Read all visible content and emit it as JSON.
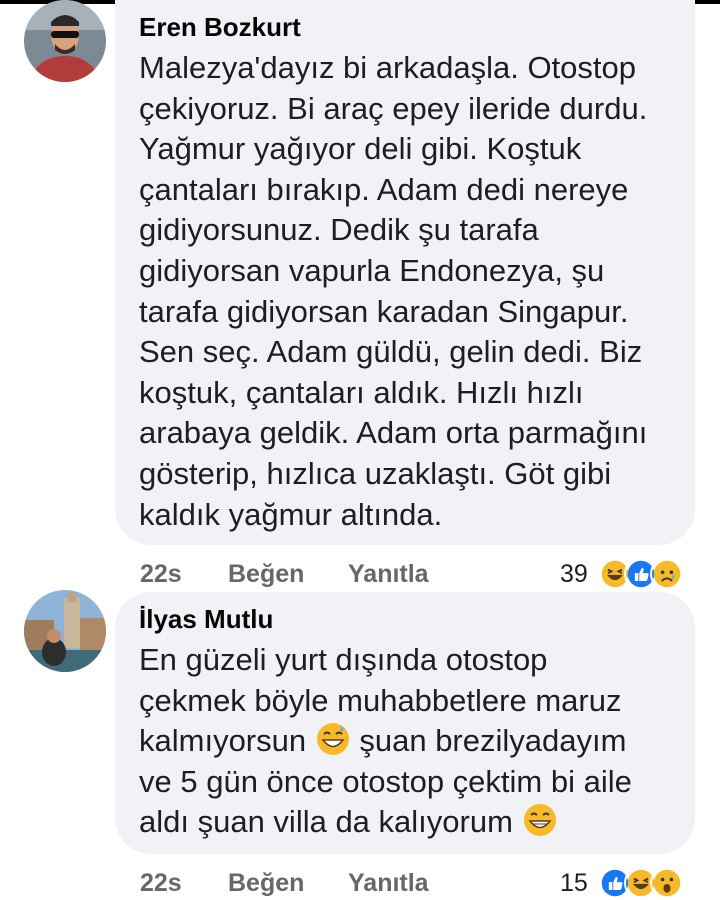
{
  "comments": [
    {
      "author": "Eren Bozkurt",
      "lines": [
        "Malezya'dayız bi arkadaşla. Otostop",
        "çekiyoruz. Bi araç epey ileride durdu.",
        "Yağmur yağıyor deli gibi. Koştuk",
        "çantaları bırakıp. Adam dedi nereye",
        "gidiyorsunuz. Dedik şu tarafa",
        "gidiyorsan vapurla Endonezya, şu",
        "tarafa gidiyorsan karadan Singapur.",
        "Sen seç. Adam güldü, gelin dedi. Biz",
        "koştuk, çantaları aldık. Hızlı hızlı",
        "arabaya geldik. Adam orta parmağını",
        "gösterip, hızlıca uzaklaştı. Göt gibi",
        "kaldık yağmur altında."
      ],
      "time": "22s",
      "like_label": "Beğen",
      "reply_label": "Yanıtla",
      "reaction_count": "39",
      "reactions": [
        "haha-icon",
        "like-icon",
        "sad-icon"
      ]
    },
    {
      "author": "İlyas Mutlu",
      "lines": [
        "En güzeli yurt dışında otostop",
        "çekmek böyle muhabbetlere maruz",
        "kalmıyorsun",
        "ve 5 gün önce otostop çektim bi aile",
        "aldı şuan villa da kalıyorum"
      ],
      "line3_after": "şuan brezilyadayım",
      "time": "22s",
      "like_label": "Beğen",
      "reply_label": "Yanıtla",
      "reaction_count": "15",
      "reactions": [
        "like-icon",
        "haha-icon",
        "wow-icon"
      ]
    }
  ],
  "colors": {
    "bubble": "#f0f2f5",
    "meta": "#65676b",
    "like_blue": "#1877f2",
    "emoji_yellow": "#f7b928"
  }
}
